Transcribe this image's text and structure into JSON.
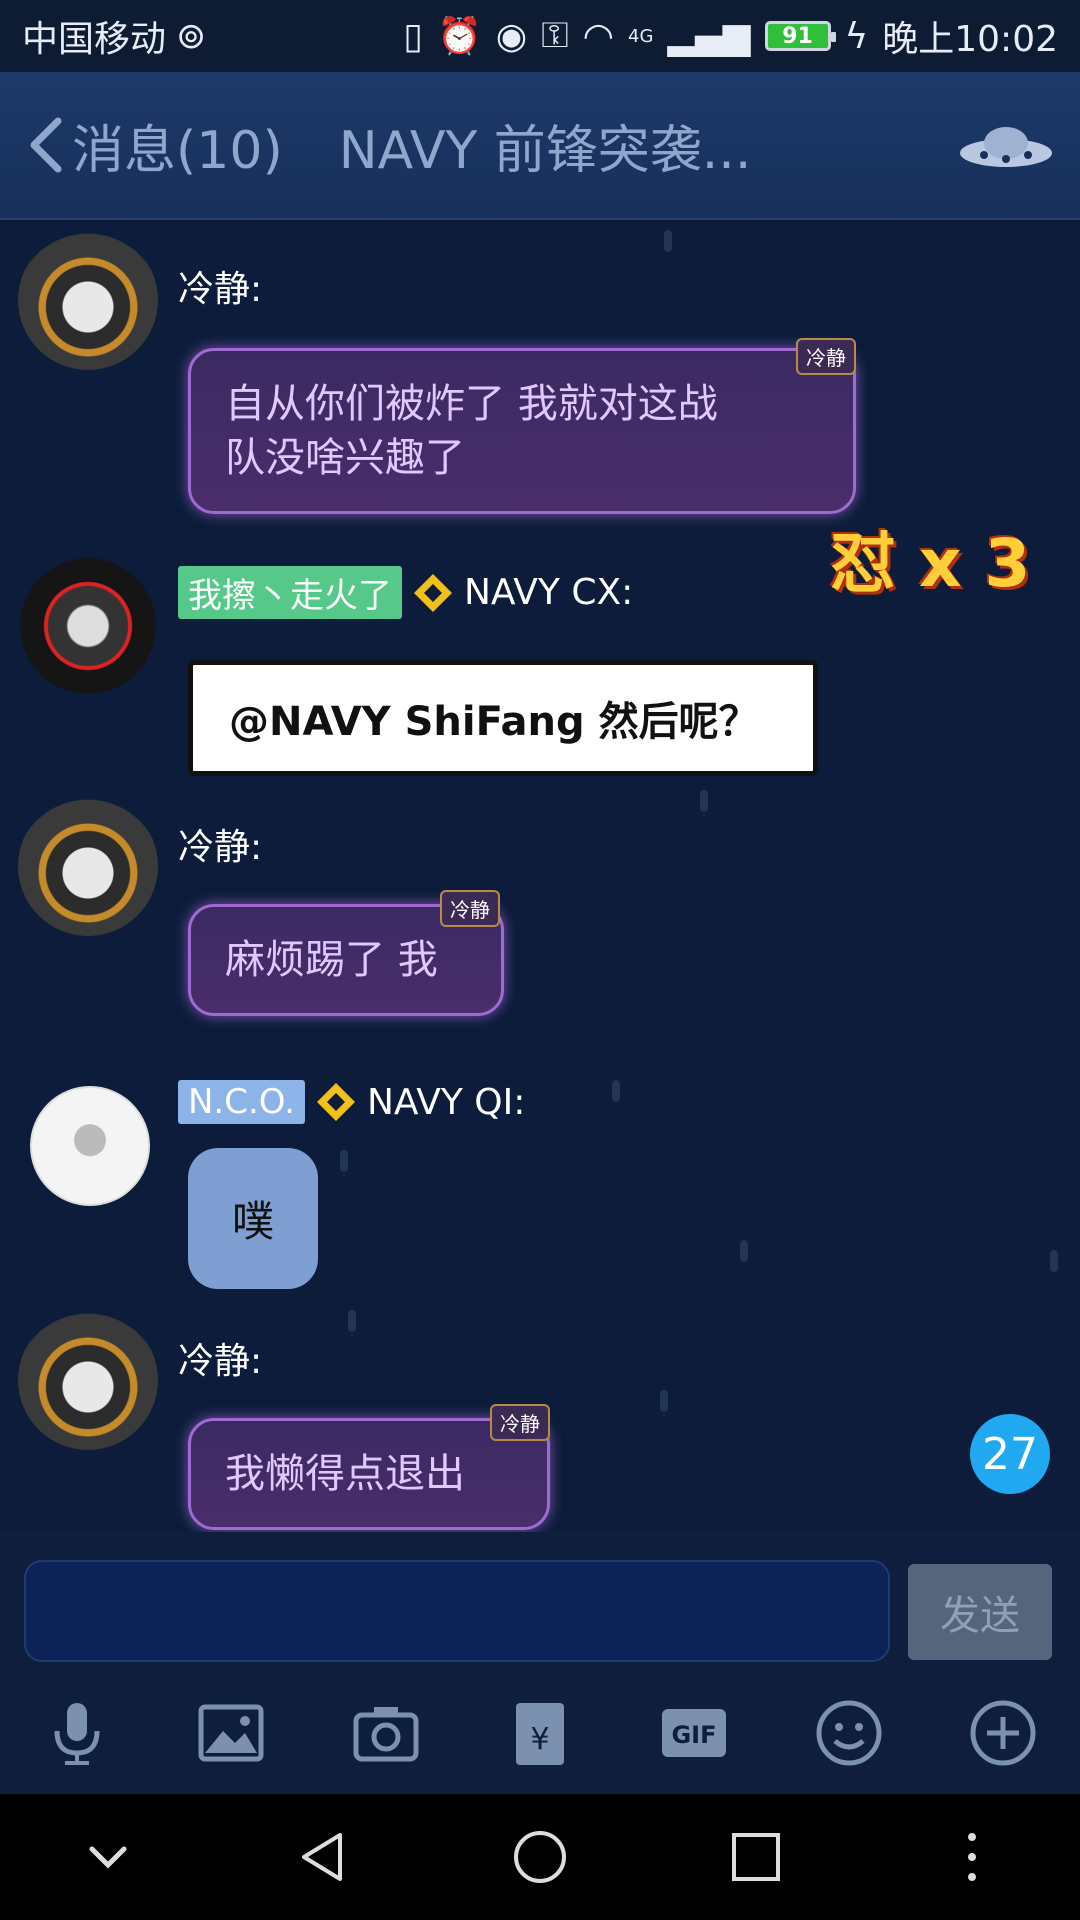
{
  "status_bar": {
    "carrier": "中国移动",
    "network": "4G",
    "battery": "91",
    "time": "晚上10:02"
  },
  "header": {
    "back_label": "消息(10)",
    "title": "NAVY 前锋突袭..."
  },
  "messages": [
    {
      "sender": "冷静:",
      "text_line1": "自从你们被炸了 我就对这战",
      "text_line2": "队没啥兴趣了",
      "badge": "冷静"
    },
    {
      "title_tag": "我擦丶走火了",
      "sender": "NAVY CX:",
      "text": "@NAVY ShiFang 然后呢？"
    },
    {
      "sender": "冷静:",
      "text": "麻烦踢了 我",
      "badge": "冷静"
    },
    {
      "title_tag": "N.C.O.",
      "sender": "NAVY QI:",
      "text": "噗"
    },
    {
      "sender": "冷静:",
      "text": "我懒得点退出",
      "badge": "冷静"
    }
  ],
  "sticker": "怼 x 3",
  "unread_count": "27",
  "input": {
    "placeholder": "",
    "send_label": "发送"
  },
  "toolbar": {
    "gif_label": "GIF"
  },
  "colors": {
    "background": "#0c1c3a",
    "header": "#1e3a6a",
    "unread_badge": "#20a8f0",
    "bubble_purple_border": "#a06ad0"
  }
}
